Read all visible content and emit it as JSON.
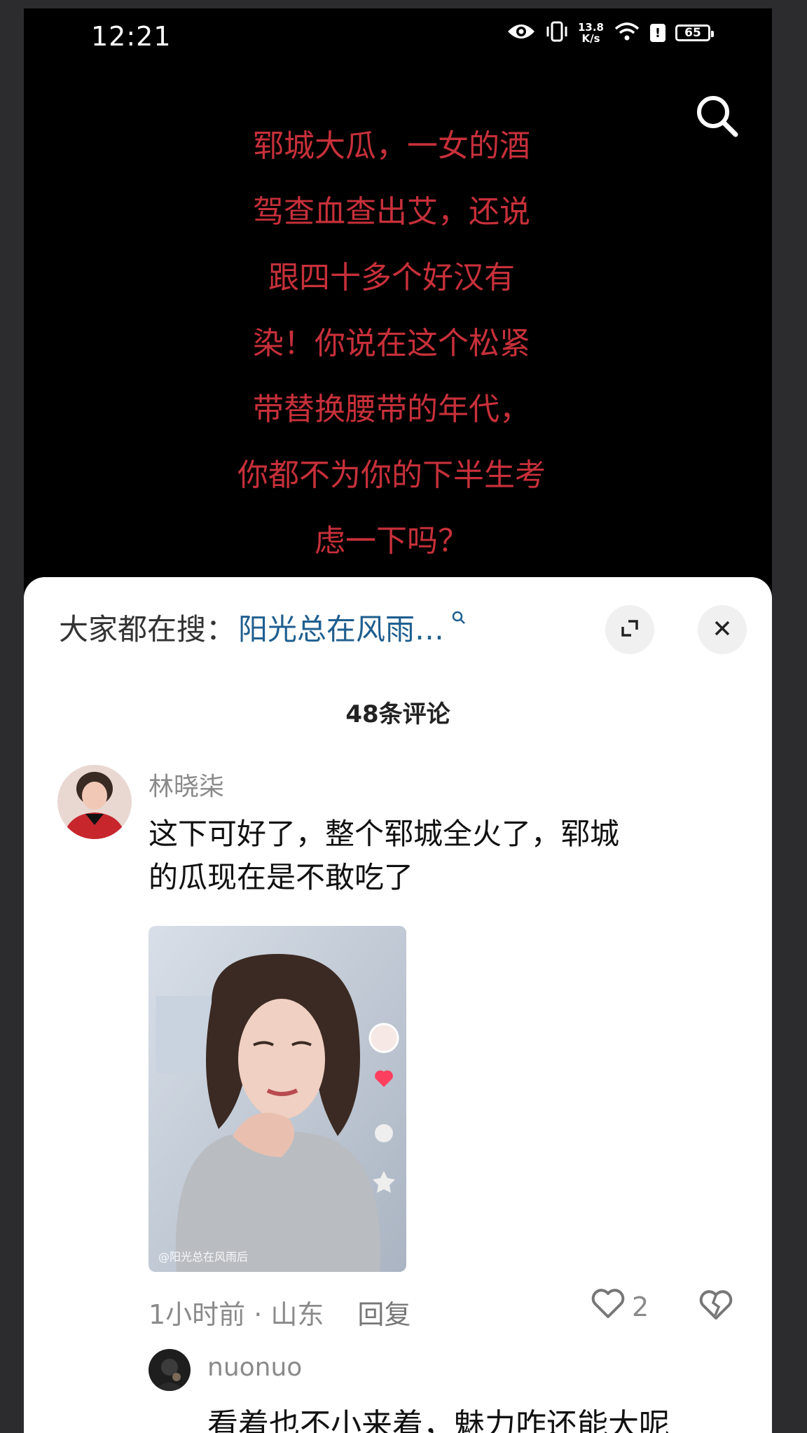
{
  "status_bar": {
    "time": "12:21",
    "speed_value": "13.8",
    "speed_unit": "K/s",
    "battery": "65",
    "alert": "!"
  },
  "video": {
    "caption_lines": [
      "郓城大瓜，一女的酒",
      "驾查血查出艾，还说",
      "跟四十多个好汉有",
      "染！你说在这个松紧",
      "带替换腰带的年代，",
      "你都不为你的下半生考",
      "虑一下吗？"
    ],
    "caption_color": "#c7303a"
  },
  "search_bar": {
    "prefix": "大家都在搜：",
    "term": "阳光总在风雨…"
  },
  "comments_header": {
    "count_label": "48条评论"
  },
  "comments": [
    {
      "user": "林晓柒",
      "text_line1": "这下可好了，整个郓城全火了，郓城",
      "text_line2": "的瓜现在是不敢吃了",
      "image_caption": "@阳光总在风雨后",
      "time_location": "1小时前 · 山东",
      "reply_label": "回复",
      "likes": "2"
    }
  ],
  "replies": [
    {
      "user": "nuonuo",
      "text": "看着也不小来着，魅力咋还能大呢"
    }
  ],
  "icons": [
    "eye-icon",
    "vibrate-icon",
    "wifi-icon",
    "search-icon",
    "expand-icon",
    "close-icon",
    "heart-icon",
    "dislike-icon"
  ]
}
